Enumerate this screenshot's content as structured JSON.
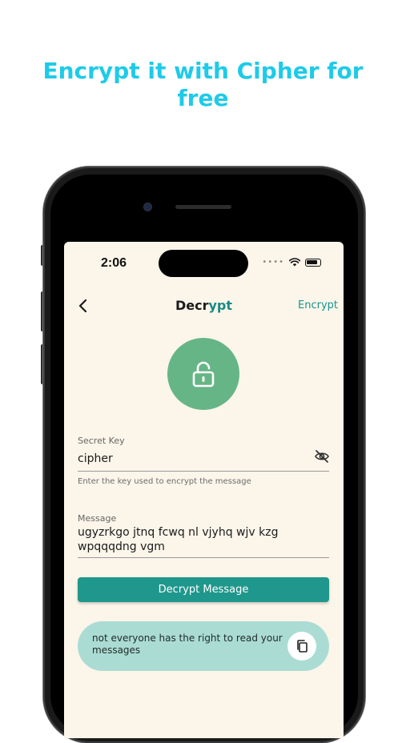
{
  "headline": {
    "line1": "Encrypt it with Cipher for",
    "line2": "free"
  },
  "status_bar": {
    "time": "2:06",
    "signal_dots": "••••"
  },
  "nav": {
    "title_part1": "Decr",
    "title_part2": "ypt",
    "action_label": "Encrypt",
    "back_icon": "chevron-left-icon"
  },
  "lock_icon": "unlock-icon",
  "secret_key": {
    "label": "Secret Key",
    "value": "cipher",
    "helper": "Enter the key used to encrypt the message",
    "toggle_icon": "eye-off-icon"
  },
  "message": {
    "label": "Message",
    "line1": "ugyzrkgo jtnq fcwq nl vjyhq wjv kzg",
    "line2": "wpqqqdng vgm"
  },
  "decrypt_button": {
    "label": "Decrypt Message"
  },
  "result": {
    "line1": "not everyone has the right to read your",
    "line2": "messages",
    "copy_icon": "copy-icon"
  },
  "colors": {
    "headline": "#1ecbe8",
    "screen_bg": "#fbf5ea",
    "accent": "#1f978c",
    "lock_circle": "#66b586",
    "result_bg": "#abdcd4"
  }
}
